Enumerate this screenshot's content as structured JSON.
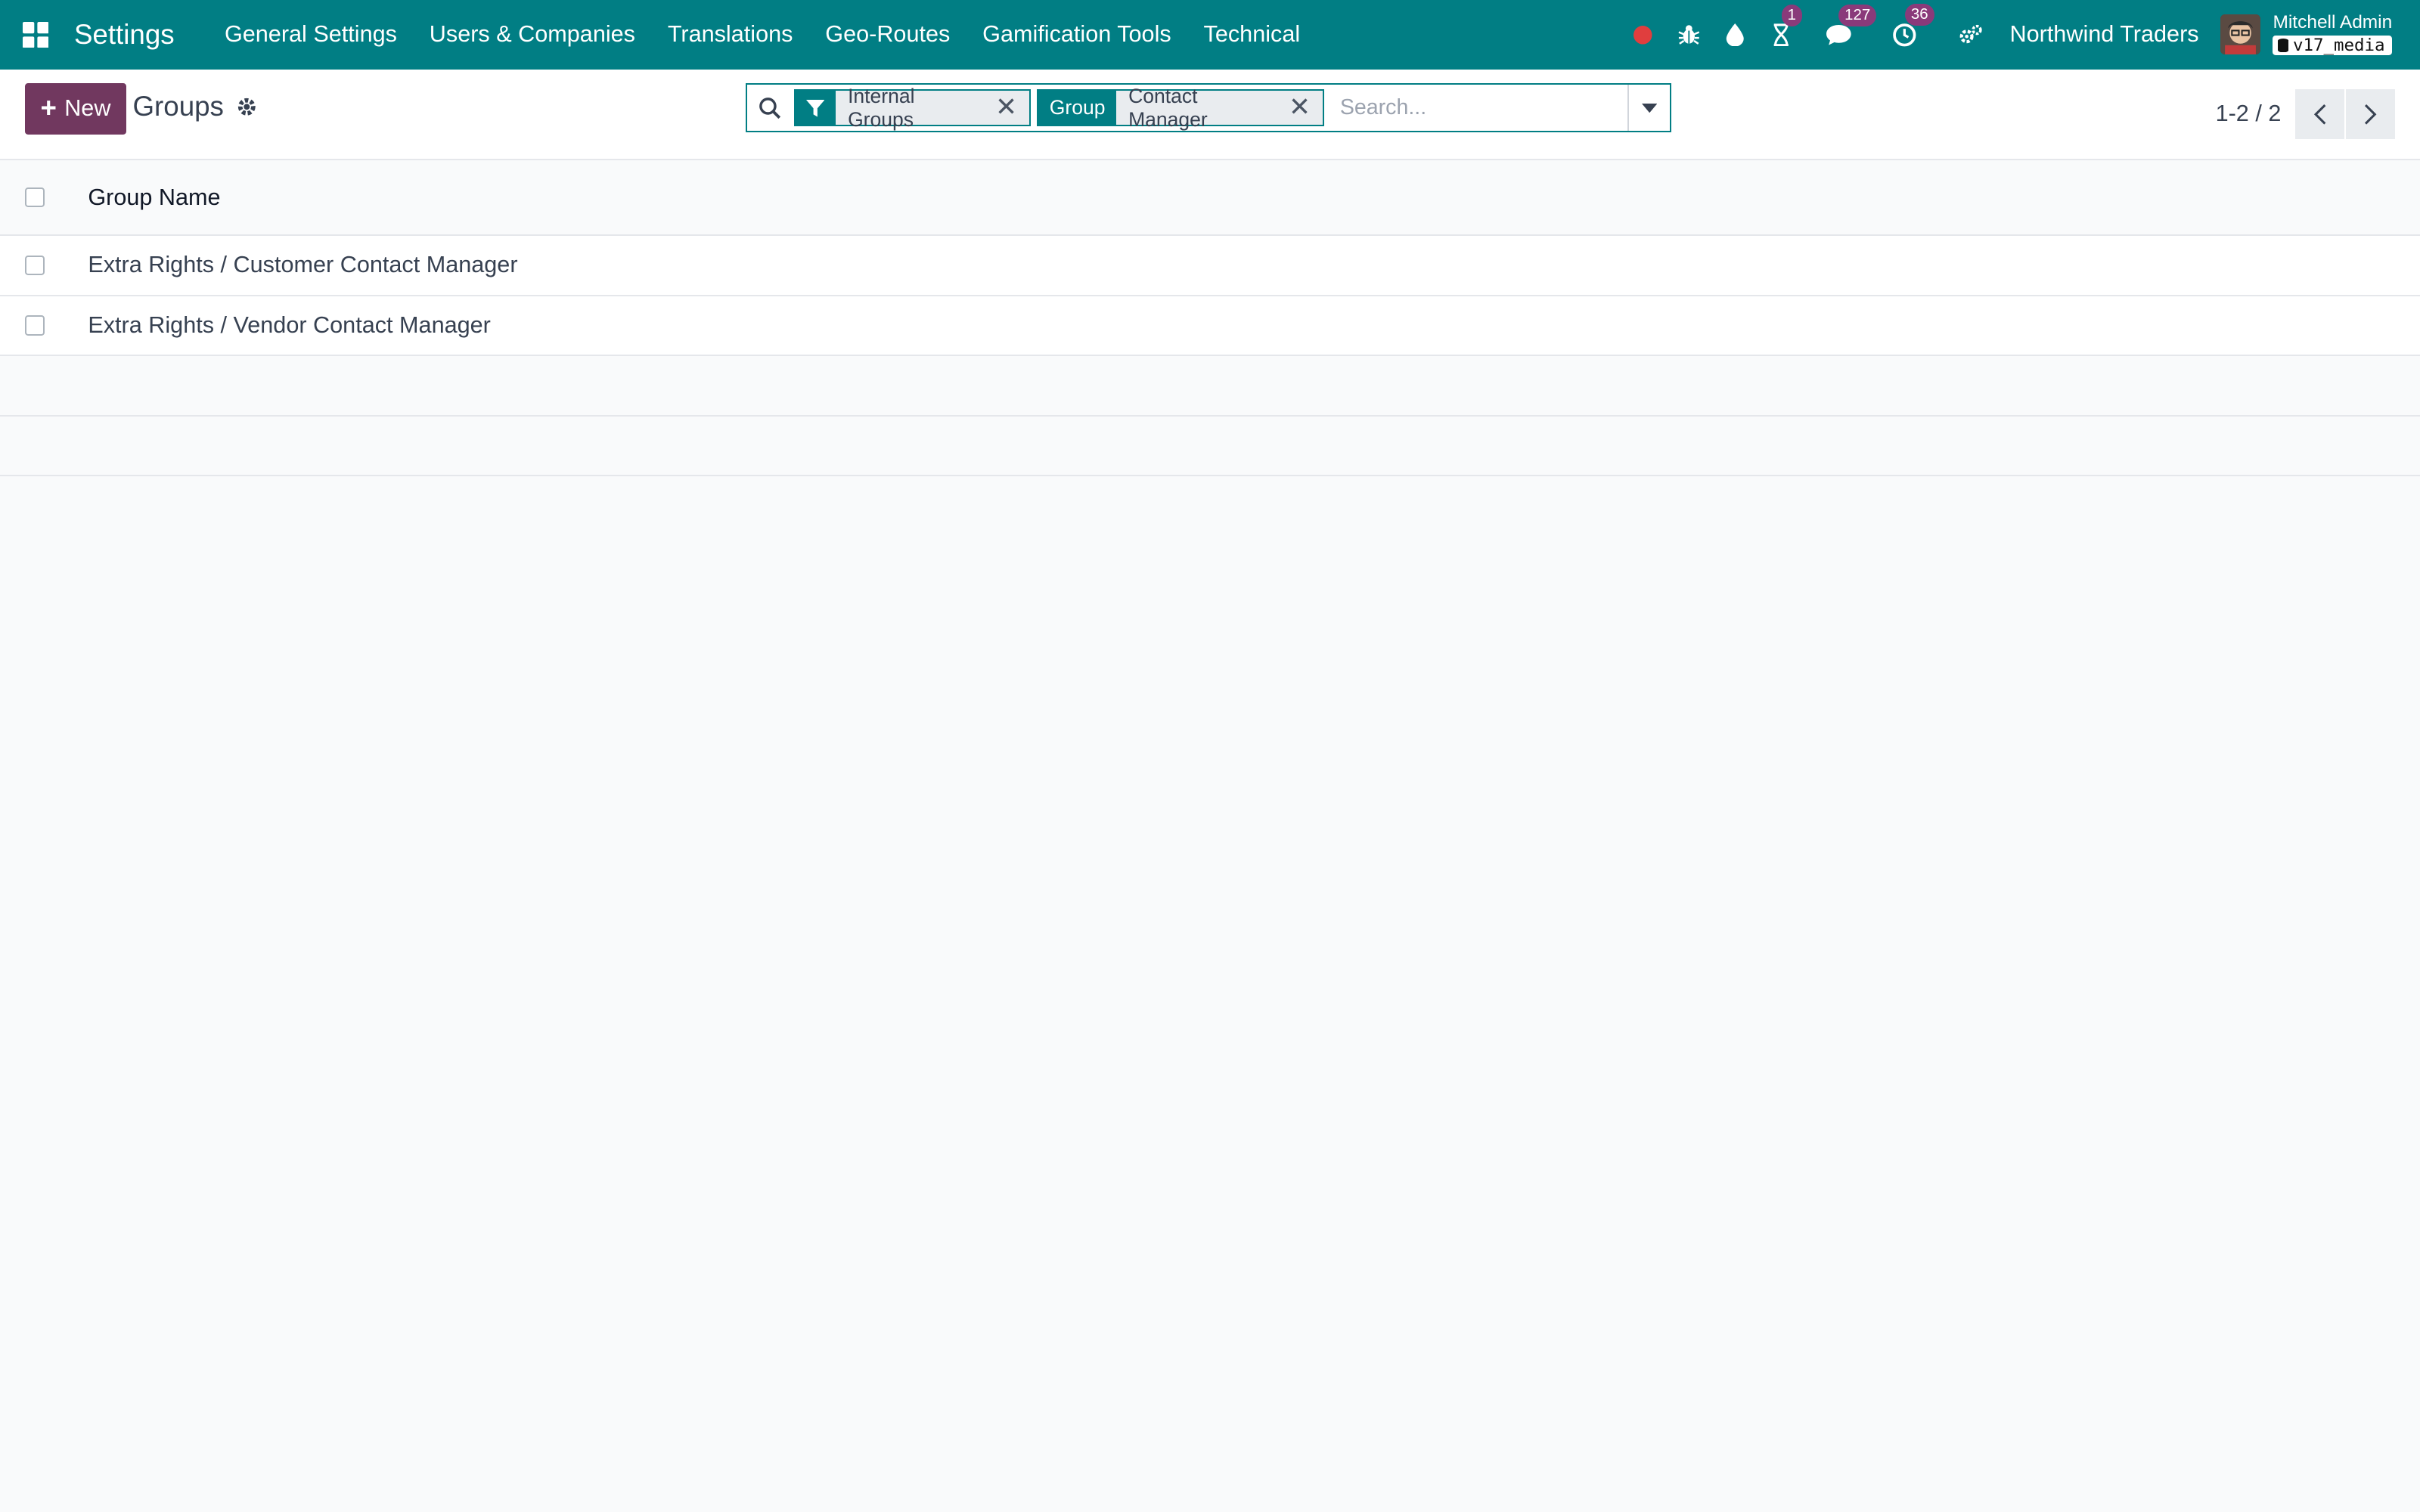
{
  "navbar": {
    "brand": "Settings",
    "menu": [
      "General Settings",
      "Users & Companies",
      "Translations",
      "Geo-Routes",
      "Gamification Tools",
      "Technical"
    ],
    "badges": {
      "activities": "1",
      "messages": "127",
      "updates": "36"
    },
    "company": "Northwind Traders",
    "user_name": "Mitchell Admin",
    "database": "v17_media"
  },
  "control": {
    "new_label": "New",
    "title": "Groups",
    "search": {
      "placeholder": "Search...",
      "facets": [
        {
          "label_icon": "filter-icon",
          "value": "Internal Groups"
        },
        {
          "label": "Group",
          "value": "Contact Manager"
        }
      ]
    },
    "pager": "1-2 / 2"
  },
  "list": {
    "columns": [
      "Group Name"
    ],
    "rows": [
      "Extra Rights / Customer Contact Manager",
      "Extra Rights / Vendor Contact Manager"
    ]
  },
  "colors": {
    "brand": "#017e84",
    "primary": "#71385f",
    "badge": "#8a3a7a"
  }
}
